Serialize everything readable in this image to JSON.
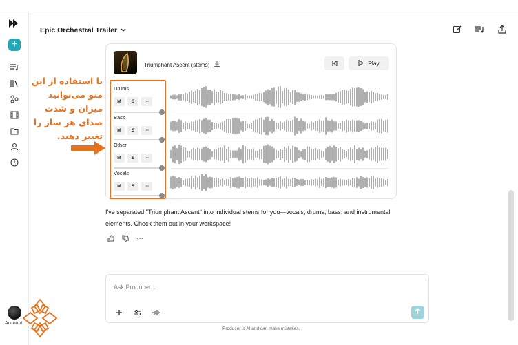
{
  "header": {
    "title": "Epic Orchestral Trailer",
    "icons": [
      "edit-icon",
      "queue-icon",
      "share-icon"
    ]
  },
  "sidebar": {
    "new_label": "+",
    "account_label": "Account",
    "items": [
      "queue-icon",
      "library-icon",
      "connections-icon",
      "video-icon",
      "folder-icon",
      "user-icon",
      "history-icon"
    ]
  },
  "player": {
    "track_title": "Triumphant Ascent (stems)",
    "play_label": "Play",
    "stems": [
      {
        "name": "Drums",
        "mute": "M",
        "solo": "S",
        "more": "···",
        "volume": 1.0
      },
      {
        "name": "Bass",
        "mute": "M",
        "solo": "S",
        "more": "···",
        "volume": 1.0
      },
      {
        "name": "Other",
        "mute": "M",
        "solo": "S",
        "more": "···",
        "volume": 1.0
      },
      {
        "name": "Vocals",
        "mute": "M",
        "solo": "S",
        "more": "···",
        "volume": 1.0
      }
    ]
  },
  "annotation": {
    "text": "با استفاده از این منو می‌توانید میزان و شدت صدای هر ساز را تغییر دهید."
  },
  "message": {
    "text": "I've separated \"Triumphant Ascent\" into individual stems for you—vocals, drums, bass, and instrumental elements. Check them out in your workspace!"
  },
  "composer": {
    "placeholder": "Ask Producer...",
    "disclaimer": "Producer is AI and can make mistakes."
  },
  "colors": {
    "accent": "#23a7b5",
    "annotation": "#e8721c",
    "send_disabled": "#9fd3dc"
  }
}
